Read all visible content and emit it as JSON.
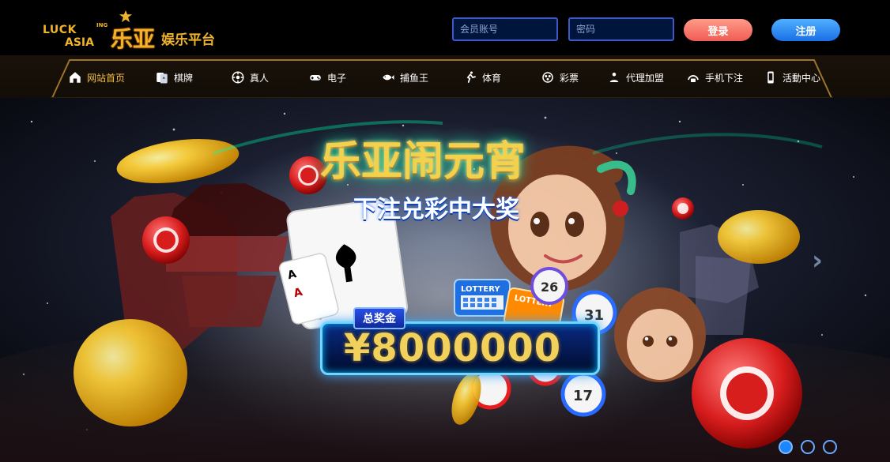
{
  "brand": {
    "logo_lucky": "LUCK",
    "logo_ing": "ING",
    "logo_asia": "ASIA",
    "logo_cn": "乐亚",
    "tagline": "娱乐平台"
  },
  "login": {
    "username_placeholder": "会员账号",
    "password_placeholder": "密码",
    "login_label": "登录",
    "register_label": "注册"
  },
  "nav": {
    "items": [
      {
        "label": "网站首页",
        "icon": "home-icon",
        "active": true
      },
      {
        "label": "棋牌",
        "icon": "cards-icon"
      },
      {
        "label": "真人",
        "icon": "roulette-icon"
      },
      {
        "label": "电子",
        "icon": "gamepad-icon"
      },
      {
        "label": "捕鱼王",
        "icon": "fish-icon"
      },
      {
        "label": "体育",
        "icon": "runner-icon"
      },
      {
        "label": "彩票",
        "icon": "lottery-icon"
      },
      {
        "label": "代理加盟",
        "icon": "agent-icon"
      },
      {
        "label": "手机下注",
        "icon": "mobile-bet-icon"
      },
      {
        "label": "活動中心",
        "icon": "phone-icon"
      }
    ]
  },
  "banner": {
    "title": "乐亚闹元宵",
    "subtitle": "下注兑彩中大奖",
    "jackpot_label": "总奖金",
    "jackpot_value": "¥8000000",
    "ball_numbers": [
      "26",
      "31",
      "17"
    ],
    "lottery_ticket": "LOTTERY",
    "carousel_dots": 3,
    "active_dot_index": 0
  },
  "colors": {
    "gold": "#f0b42a",
    "nav_active": "#f1c044",
    "login_btn": "#f05b55",
    "register_btn": "#1a6fe6",
    "input_border": "#3d58c8"
  }
}
